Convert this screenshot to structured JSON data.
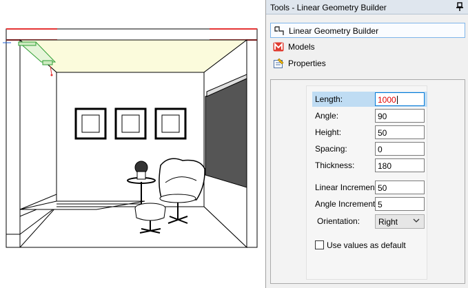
{
  "panel": {
    "title": "Tools - Linear Geometry Builder",
    "pin_icon": "pin-icon"
  },
  "tools": [
    {
      "label": "Linear Geometry Builder",
      "icon": "linear-geometry-icon",
      "selected": true
    },
    {
      "label": "Models",
      "icon": "models-icon",
      "selected": false
    },
    {
      "label": "Properties",
      "icon": "properties-icon",
      "selected": false
    }
  ],
  "form": {
    "length": {
      "label": "Length:",
      "value": "1000"
    },
    "angle": {
      "label": "Angle:",
      "value": "90"
    },
    "height": {
      "label": "Height:",
      "value": "50"
    },
    "spacing": {
      "label": "Spacing:",
      "value": "0"
    },
    "thickness": {
      "label": "Thickness:",
      "value": "180"
    },
    "linear_increment": {
      "label": "Linear Increment:",
      "value": "50"
    },
    "angle_increment": {
      "label": "Angle Increment:",
      "value": "5"
    },
    "orientation": {
      "label": "Orientation:",
      "value": "Right"
    },
    "use_default": {
      "label": "Use values as default",
      "checked": false
    }
  },
  "colors": {
    "accent": "#0078d7",
    "highlight": "#bfdcf3",
    "active_value": "#e00000",
    "ceiling_yellow": "#fbfbdc",
    "red_line": "#e53333"
  }
}
